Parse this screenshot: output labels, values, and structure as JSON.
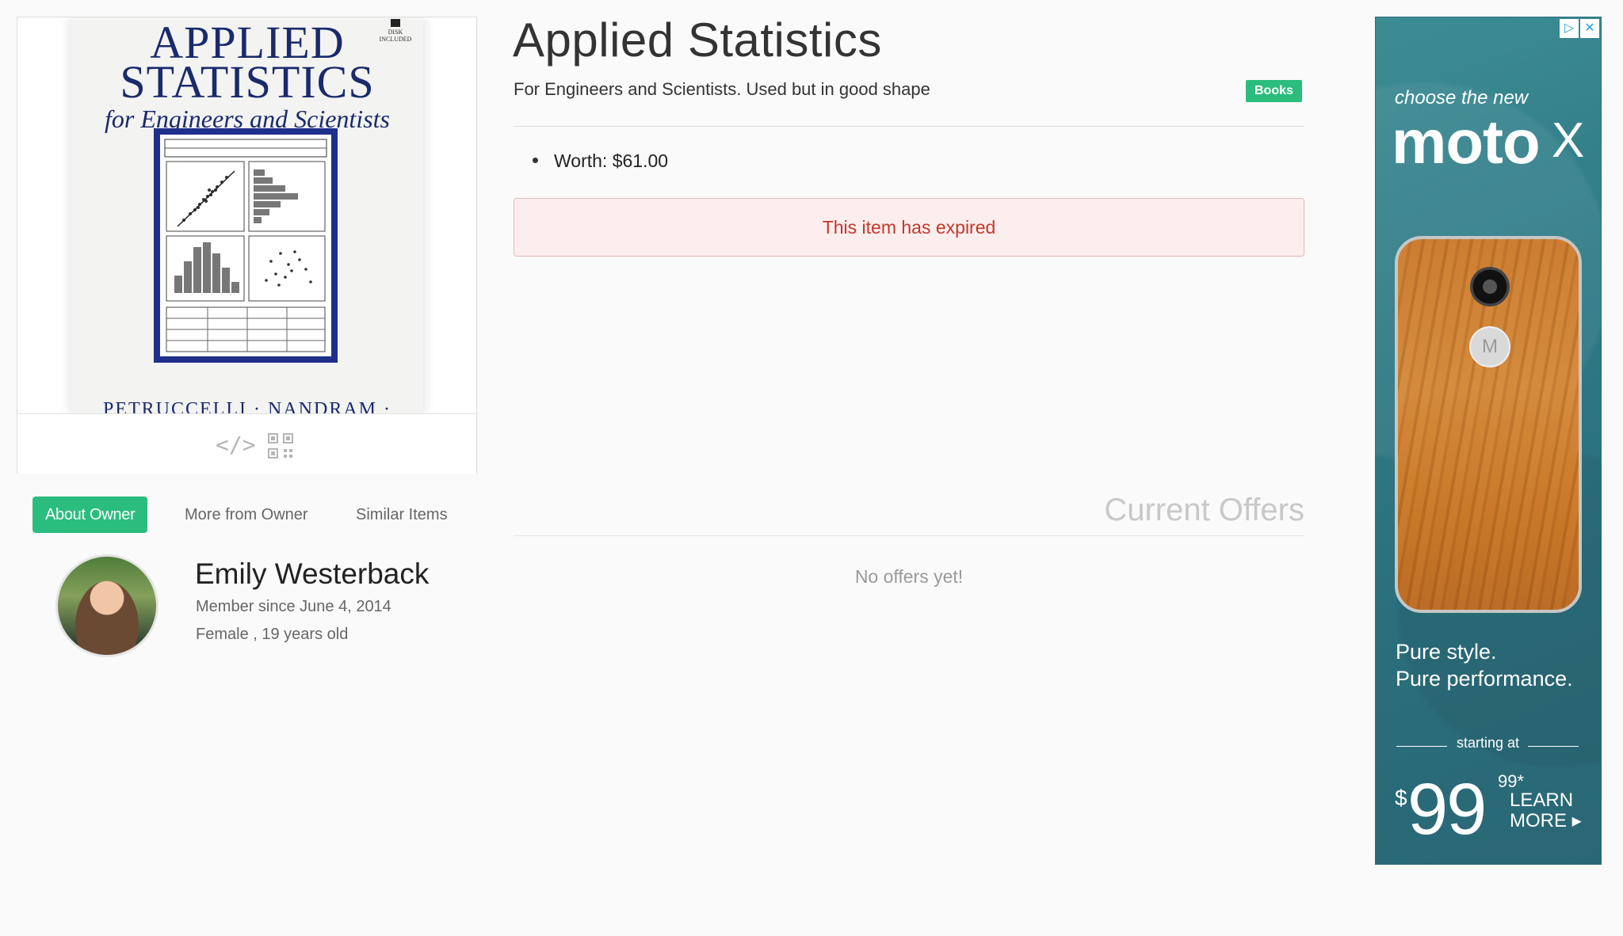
{
  "item": {
    "title": "Applied Statistics",
    "description": "For Engineers and Scientists. Used but in good shape",
    "category": "Books",
    "worth": "Worth: $61.00",
    "status_message": "This item has expired",
    "cover": {
      "title_line1": "APPLIED",
      "title_line2": "STATISTICS",
      "subtitle": "for Engineers and Scientists",
      "badge": "DISK INCLUDED",
      "authors": "PETRUCCELLI · NANDRAM · CHEN"
    }
  },
  "card_toolbar": {
    "embed_icon": "code-embed-icon",
    "qr_icon": "qr-code-icon"
  },
  "owner_tabs": [
    {
      "label": "About Owner",
      "active": true
    },
    {
      "label": "More from Owner",
      "active": false
    },
    {
      "label": "Similar Items",
      "active": false
    }
  ],
  "owner": {
    "name": "Emily Westerback",
    "member_since": "Member since June 4, 2014",
    "info": "Female , 19 years old"
  },
  "offers": {
    "heading": "Current Offers",
    "empty_message": "No offers yet!"
  },
  "ad": {
    "small": "choose the new",
    "brand": "moto",
    "brand_mark": "X",
    "tagline1": "Pure style.",
    "tagline2": "Pure performance.",
    "starting": "starting at",
    "dollar": "$",
    "price": "99",
    "cents": "99*",
    "cta_line1": "LEARN",
    "cta_line2": "MORE ▸",
    "choices": [
      "▷",
      "✕"
    ]
  },
  "colors": {
    "accent": "#2bbd7e",
    "expired_text": "#c0392b",
    "expired_bg": "#fdeeee"
  }
}
